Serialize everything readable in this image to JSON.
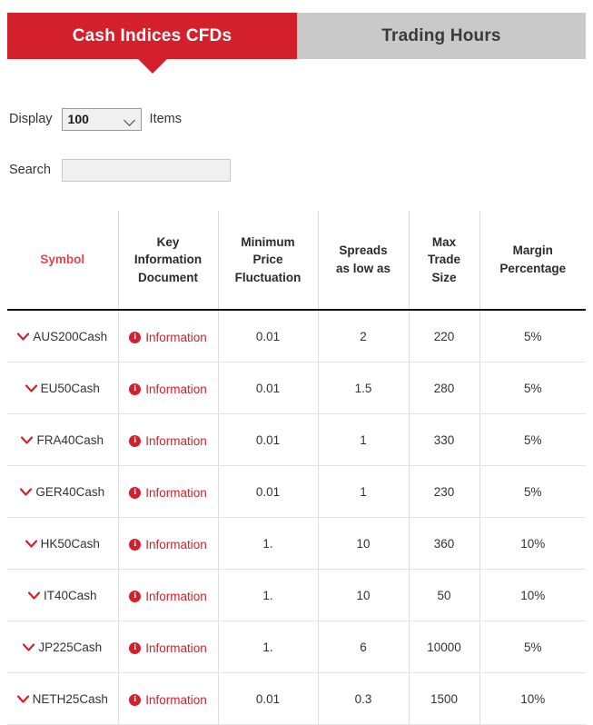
{
  "tabs": [
    {
      "label": "Cash Indices CFDs",
      "active": true
    },
    {
      "label": "Trading Hours",
      "active": false
    }
  ],
  "controls": {
    "display_label": "Display",
    "display_value": "100",
    "items_label": "Items",
    "search_label": "Search",
    "search_value": "",
    "search_placeholder": ""
  },
  "colors": {
    "brand_red": "#d4202c",
    "tab_inactive": "#c9c9c9",
    "symbol_header": "#e2454a"
  },
  "table": {
    "headers": [
      "Symbol",
      "Key Information Document",
      "Minimum Price Fluctuation",
      "Spreads as low as",
      "Max Trade Size",
      "Margin Percentage"
    ],
    "header_lines": [
      [
        "Symbol"
      ],
      [
        "Key",
        "Information",
        "Document"
      ],
      [
        "Minimum",
        "Price",
        "Fluctuation"
      ],
      [
        "Spreads",
        "as low as"
      ],
      [
        "Max",
        "Trade",
        "Size"
      ],
      [
        "Margin",
        "Percentage"
      ]
    ],
    "info_label": "Information",
    "rows": [
      {
        "symbol": "AUS200Cash",
        "kid": "Information",
        "min_fluctuation": "0.01",
        "spread": "2",
        "max_trade": "220",
        "margin": "5%"
      },
      {
        "symbol": "EU50Cash",
        "kid": "Information",
        "min_fluctuation": "0.01",
        "spread": "1.5",
        "max_trade": "280",
        "margin": "5%"
      },
      {
        "symbol": "FRA40Cash",
        "kid": "Information",
        "min_fluctuation": "0.01",
        "spread": "1",
        "max_trade": "330",
        "margin": "5%"
      },
      {
        "symbol": "GER40Cash",
        "kid": "Information",
        "min_fluctuation": "0.01",
        "spread": "1",
        "max_trade": "230",
        "margin": "5%"
      },
      {
        "symbol": "HK50Cash",
        "kid": "Information",
        "min_fluctuation": "1.",
        "spread": "10",
        "max_trade": "360",
        "margin": "10%"
      },
      {
        "symbol": "IT40Cash",
        "kid": "Information",
        "min_fluctuation": "1.",
        "spread": "10",
        "max_trade": "50",
        "margin": "10%"
      },
      {
        "symbol": "JP225Cash",
        "kid": "Information",
        "min_fluctuation": "1.",
        "spread": "6",
        "max_trade": "10000",
        "margin": "5%"
      },
      {
        "symbol": "NETH25Cash",
        "kid": "Information",
        "min_fluctuation": "0.01",
        "spread": "0.3",
        "max_trade": "1500",
        "margin": "10%"
      }
    ]
  }
}
